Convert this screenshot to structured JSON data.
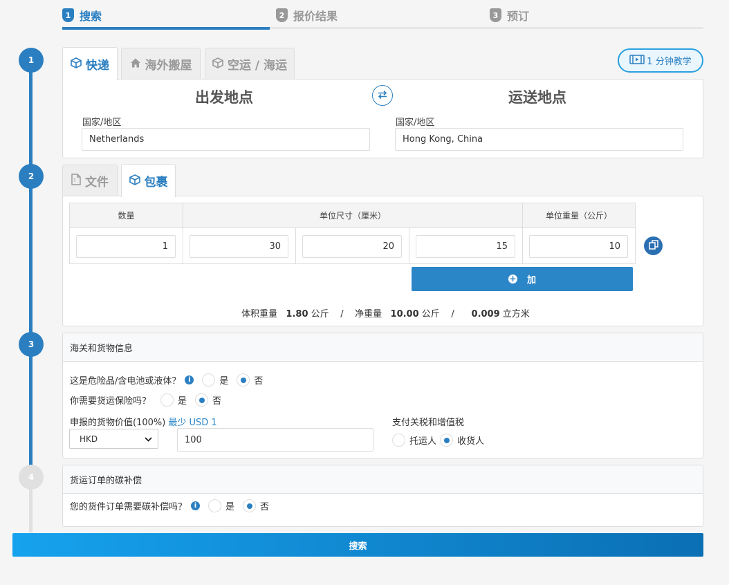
{
  "steps": [
    {
      "num": "1",
      "label": "搜索"
    },
    {
      "num": "2",
      "label": "报价结果"
    },
    {
      "num": "3",
      "label": "预订"
    }
  ],
  "timeline": [
    "1",
    "2",
    "3",
    "4"
  ],
  "service_tabs": [
    {
      "label": "快递",
      "icon": "box-icon"
    },
    {
      "label": "海外搬屋",
      "icon": "home-icon"
    },
    {
      "label": "空运 / 海运",
      "icon": "box-icon"
    }
  ],
  "tutorial_label": "1 分钟教学",
  "origin": {
    "heading": "出发地点",
    "label": "国家/地区",
    "value": "Netherlands"
  },
  "destination": {
    "heading": "运送地点",
    "label": "国家/地区",
    "value": "Hong Kong, China"
  },
  "parcel_tabs": [
    {
      "label": "文件",
      "icon": "document-icon"
    },
    {
      "label": "包裹",
      "icon": "box-icon"
    }
  ],
  "package_table": {
    "headers": {
      "qty": "数量",
      "dims": "单位尺寸（厘米）",
      "weight": "单位重量（公斤）"
    },
    "row": {
      "qty": "1",
      "length": "30",
      "width": "20",
      "height": "15",
      "weight": "10"
    }
  },
  "add_label": "加",
  "summary": {
    "vol_label": "体积重量",
    "vol_value": "1.80",
    "vol_unit": "公斤",
    "sep1": "/",
    "net_label": "净重量",
    "net_value": "10.00",
    "net_unit": "公斤",
    "sep2": "/",
    "cbm_value": "0.009",
    "cbm_unit": "立方米"
  },
  "customs": {
    "title": "海关和货物信息",
    "dangerous_q": "这是危险品/含电池或液体？",
    "insurance_q": "你需要货运保险吗？",
    "yes": "是",
    "no": "否",
    "declared_label": "申报的货物价值(100%)",
    "declared_min": "最少 USD 1",
    "currency": "HKD",
    "declared_value": "100",
    "duty_label": "支付关税和增值税",
    "shipper": "托运人",
    "consignee": "收货人"
  },
  "carbon": {
    "title": "货运订单的碳补偿",
    "question": "您的货件订单需要碳补偿吗？",
    "yes": "是",
    "no": "否"
  },
  "search_label": "搜索"
}
